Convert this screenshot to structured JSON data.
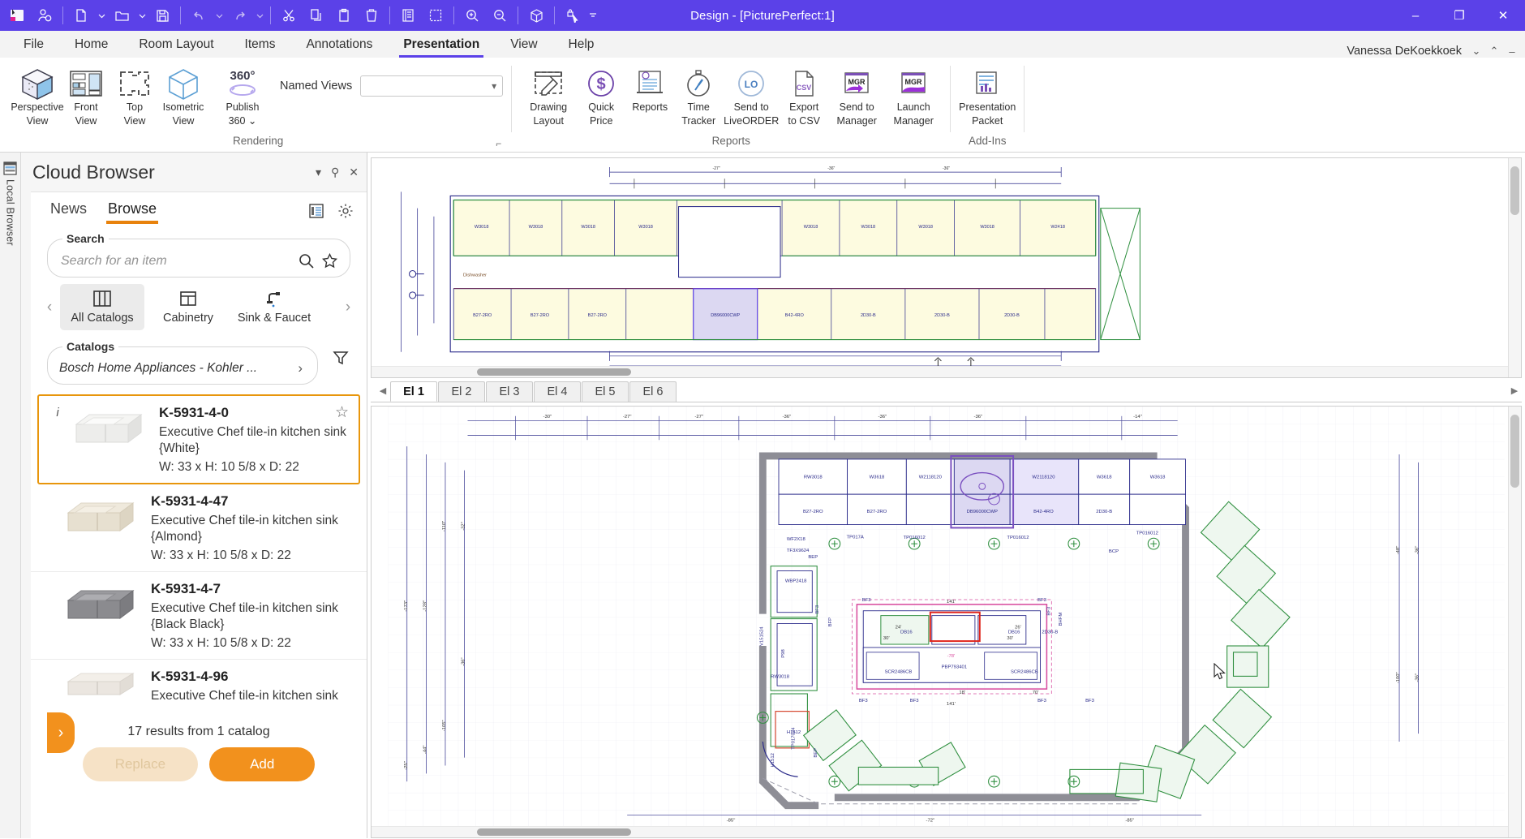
{
  "window": {
    "title": "Design - [PicturePerfect:1]",
    "minimize": "–",
    "restore": "❐",
    "close": "✕"
  },
  "quick_access": [
    {
      "name": "app-logo-icon",
      "label": "App"
    },
    {
      "name": "user-group-icon",
      "label": "Clients"
    },
    {
      "name": "new-file-icon",
      "label": "New"
    },
    {
      "name": "open-folder-icon",
      "label": "Open"
    },
    {
      "name": "save-icon",
      "label": "Save"
    },
    {
      "name": "undo-icon",
      "label": "Undo"
    },
    {
      "name": "redo-icon",
      "label": "Redo"
    },
    {
      "name": "cut-icon",
      "label": "Cut"
    },
    {
      "name": "copy-icon",
      "label": "Copy"
    },
    {
      "name": "paste-icon",
      "label": "Paste"
    },
    {
      "name": "delete-icon",
      "label": "Delete"
    },
    {
      "name": "report-icon",
      "label": "Report"
    },
    {
      "name": "edit-drawing-icon",
      "label": "Edit Drawing"
    },
    {
      "name": "zoom-in-icon",
      "label": "Zoom In"
    },
    {
      "name": "zoom-out-icon",
      "label": "Zoom Out"
    },
    {
      "name": "3d-box-icon",
      "label": "3D View"
    },
    {
      "name": "lock-pointer-icon",
      "label": "Lock Pointer"
    },
    {
      "name": "qat-overflow-icon",
      "label": "More"
    }
  ],
  "menu": {
    "items": [
      {
        "label": "File",
        "active": false
      },
      {
        "label": "Home",
        "active": false
      },
      {
        "label": "Room Layout",
        "active": false
      },
      {
        "label": "Items",
        "active": false
      },
      {
        "label": "Annotations",
        "active": false
      },
      {
        "label": "Presentation",
        "active": true
      },
      {
        "label": "View",
        "active": false
      },
      {
        "label": "Help",
        "active": false
      }
    ],
    "user_name": "Vanessa DeKoekkoek",
    "user_chevron": "⌄",
    "ribbon_collapse": "⌃",
    "window_minimize": "–"
  },
  "ribbon": {
    "groups": [
      {
        "label": "Rendering",
        "buttons": [
          {
            "name": "perspective-view-button",
            "label": "Perspective\nView",
            "line1": "Perspective",
            "line2": "View",
            "icon": "cube-shaded-icon"
          },
          {
            "name": "front-view-button",
            "label": "Front View",
            "line1": "Front",
            "line2": "View",
            "icon": "front-elevation-icon"
          },
          {
            "name": "top-view-button",
            "label": "Top View",
            "line1": "Top",
            "line2": "View",
            "icon": "top-plan-icon"
          },
          {
            "name": "isometric-view-button",
            "label": "Isometric View",
            "line1": "Isometric",
            "line2": "View",
            "icon": "cube-outline-icon"
          },
          {
            "name": "publish-360-button",
            "label": "Publish 360",
            "line1": "Publish",
            "line2": "360 ⌄",
            "icon": "360-icon"
          }
        ],
        "named_views_label": "Named Views",
        "named_views_value": ""
      },
      {
        "label": "Reports",
        "buttons": [
          {
            "name": "drawing-layout-button",
            "line1": "Drawing",
            "line2": "Layout",
            "icon": "drawing-layout-icon"
          },
          {
            "name": "quick-price-button",
            "line1": "Quick",
            "line2": "Price",
            "icon": "dollar-circle-icon"
          },
          {
            "name": "reports-button",
            "line1": "Reports",
            "line2": "",
            "icon": "reports-icon"
          },
          {
            "name": "time-tracker-button",
            "line1": "Time",
            "line2": "Tracker",
            "icon": "stopwatch-icon"
          },
          {
            "name": "send-to-liveorder-button",
            "line1": "Send to",
            "line2": "LiveORDER",
            "icon": "liveorder-icon"
          },
          {
            "name": "export-to-csv-button",
            "line1": "Export",
            "line2": "to CSV",
            "icon": "csv-file-icon"
          },
          {
            "name": "send-to-manager-button",
            "line1": "Send to",
            "line2": "Manager",
            "icon": "mgr-send-icon"
          },
          {
            "name": "launch-manager-button",
            "line1": "Launch",
            "line2": "Manager",
            "icon": "mgr-launch-icon"
          }
        ]
      },
      {
        "label": "Add-Ins",
        "buttons": [
          {
            "name": "presentation-packet-button",
            "line1": "Presentation",
            "line2": "Packet",
            "icon": "presentation-packet-icon"
          }
        ]
      }
    ]
  },
  "rail": {
    "label": "Local Browser",
    "icon": "local-browser-icon"
  },
  "cloud_browser": {
    "title": "Cloud Browser",
    "header_buttons": [
      {
        "name": "panel-dropdown-icon",
        "glyph": "▾"
      },
      {
        "name": "panel-pin-icon",
        "glyph": "⚲"
      },
      {
        "name": "panel-close-icon",
        "glyph": "✕"
      }
    ],
    "tabs": [
      {
        "label": "News",
        "active": false,
        "name": "tab-news"
      },
      {
        "label": "Browse",
        "active": true,
        "name": "tab-browse"
      }
    ],
    "panel_icons": [
      {
        "name": "list-view-icon"
      },
      {
        "name": "settings-gear-icon"
      }
    ],
    "search": {
      "legend": "Search",
      "placeholder": "Search for an item",
      "value": "",
      "search_icon": "search-icon",
      "favorite_icon": "star-outline-icon"
    },
    "category_nav": {
      "prev": "‹",
      "next": "›",
      "tiles": [
        {
          "label": "All Catalogs",
          "active": true,
          "icon": "columns-icon",
          "name": "category-all-catalogs"
        },
        {
          "label": "Cabinetry",
          "active": false,
          "icon": "cabinet-icon",
          "name": "category-cabinetry"
        },
        {
          "label": "Sink & Faucet",
          "active": false,
          "icon": "faucet-icon",
          "name": "category-sink-faucet"
        }
      ]
    },
    "catalogs": {
      "legend": "Catalogs",
      "value": "Bosch Home Appliances - Kohler ...",
      "chevron": "›",
      "filter_icon": "filter-funnel-icon"
    },
    "results": [
      {
        "sku": "K-5931-4-0",
        "desc": "Executive Chef tile-in kitchen sink {White}",
        "dims": "W: 33 x H: 10 5/8 x D: 22",
        "selected": true,
        "info_glyph": "i",
        "star_glyph": "☆",
        "thumb_color": "#f2f2f0",
        "thumb_shade": "#dcdcda"
      },
      {
        "sku": "K-5931-4-47",
        "desc": "Executive Chef tile-in kitchen sink {Almond}",
        "dims": "W: 33 x H: 10 5/8 x D: 22",
        "selected": false,
        "thumb_color": "#ede6d8",
        "thumb_shade": "#d6cdbb"
      },
      {
        "sku": "K-5931-4-7",
        "desc": "Executive Chef tile-in kitchen sink {Black Black}",
        "dims": "W: 33 x H: 10 5/8 x D: 22",
        "selected": false,
        "thumb_color": "#8e8e92",
        "thumb_shade": "#6d6d71"
      },
      {
        "sku": "K-5931-4-96",
        "desc": "Executive Chef tile-in kitchen sink",
        "dims": "",
        "selected": false,
        "thumb_color": "#efebe6",
        "thumb_shade": "#d8d3cd"
      }
    ],
    "result_count": "17 results from 1 catalog",
    "replace_label": "Replace",
    "add_label": "Add",
    "flyout_glyph": "›"
  },
  "drawing": {
    "elevation_tabs": [
      {
        "label": "El 1",
        "active": true
      },
      {
        "label": "El 2",
        "active": false
      },
      {
        "label": "El 3",
        "active": false
      },
      {
        "label": "El 4",
        "active": false
      },
      {
        "label": "El 5",
        "active": false
      },
      {
        "label": "El 6",
        "active": false
      }
    ],
    "tab_nav_left": "◀",
    "tab_nav_right": "▶",
    "elevation_labels": [
      "W3018",
      "W3018",
      "W3018",
      "W3018",
      "W3018",
      "W2418",
      "B27-2RO",
      "B27-2RO",
      "DB96000CWP",
      "B42-4RO",
      "2D30-B"
    ],
    "plan_labels": [
      "RW3018",
      "W3618",
      "W2118120",
      "W2118120",
      "W3618",
      "W3618",
      "B27-2RO",
      "B27-2RO",
      "DB96000CWP",
      "B42-4RO",
      "2D30-B",
      "WF2X18",
      "TF3X9624",
      "TP018012",
      "TP018012",
      "TP018012",
      "TP017A",
      "WBP2418",
      "V151524",
      "RW3018",
      "B1F3",
      "B1F3",
      "BCP",
      "BEP",
      "BF3",
      "BF3",
      "BF3",
      "BF3",
      "BF3",
      "BF3",
      "DB16",
      "DB16",
      "2D30-B",
      "SCR2486CB",
      "SCR2486CB",
      "PBP793401",
      "TP016012",
      "TP017024",
      "H1512",
      "H1512"
    ],
    "dimensions_top": [
      "-30'",
      "-27'",
      "-27'",
      "-36'",
      "-36'",
      "-36'",
      "-14'"
    ],
    "dimensions_bottom": [
      "-85'",
      "-72'",
      "-85'"
    ],
    "dimensions_inner": [
      "141'",
      "141'",
      "30'",
      "18'",
      "30'",
      "24'",
      "26'",
      "70'",
      "-78'"
    ],
    "dimensions_left": [
      "-24'",
      "-32'",
      "-110'",
      "-173'",
      "-128'",
      "-36'",
      "-105'",
      "-44'",
      "-25'"
    ],
    "dimensions_right": [
      "-36'",
      "-48'",
      "-28'",
      "-100'",
      "-36'"
    ]
  }
}
